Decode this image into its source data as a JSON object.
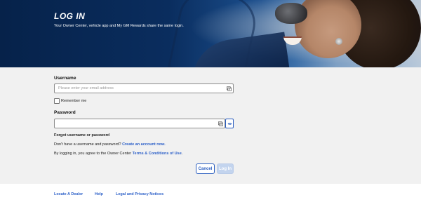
{
  "hero": {
    "title": "LOG IN",
    "subtitle": "Your Owner Center, vehicle app and My GM Rewards share the same login."
  },
  "form": {
    "username_label": "Username",
    "username_placeholder": "Please enter your email address",
    "username_value": "",
    "remember_label": "Remember me",
    "remember_checked": false,
    "password_label": "Password",
    "password_value": "",
    "forgot_link": "Forgot username or password",
    "no_account_text": "Don't have a username and password? ",
    "create_account_link": "Create an account now.",
    "agree_text": "By logging in, you agree to the Owner Center ",
    "terms_link": "Terms & Conditions of Use",
    "agree_suffix": ".",
    "cancel_label": "Cancel",
    "login_label": "Log In"
  },
  "footer": {
    "links": [
      "Locate A Dealer",
      "Help",
      "Legal and Privacy Notices"
    ]
  },
  "icons": {
    "username_field": "autofill-card-icon",
    "password_field": "autofill-card-icon",
    "show_password": "eye-icon"
  },
  "colors": {
    "hero_bg": "#0a2d5e",
    "accent": "#2b5fc8",
    "form_bg": "#f1f1f1",
    "disabled_button": "#c3d4ee"
  }
}
